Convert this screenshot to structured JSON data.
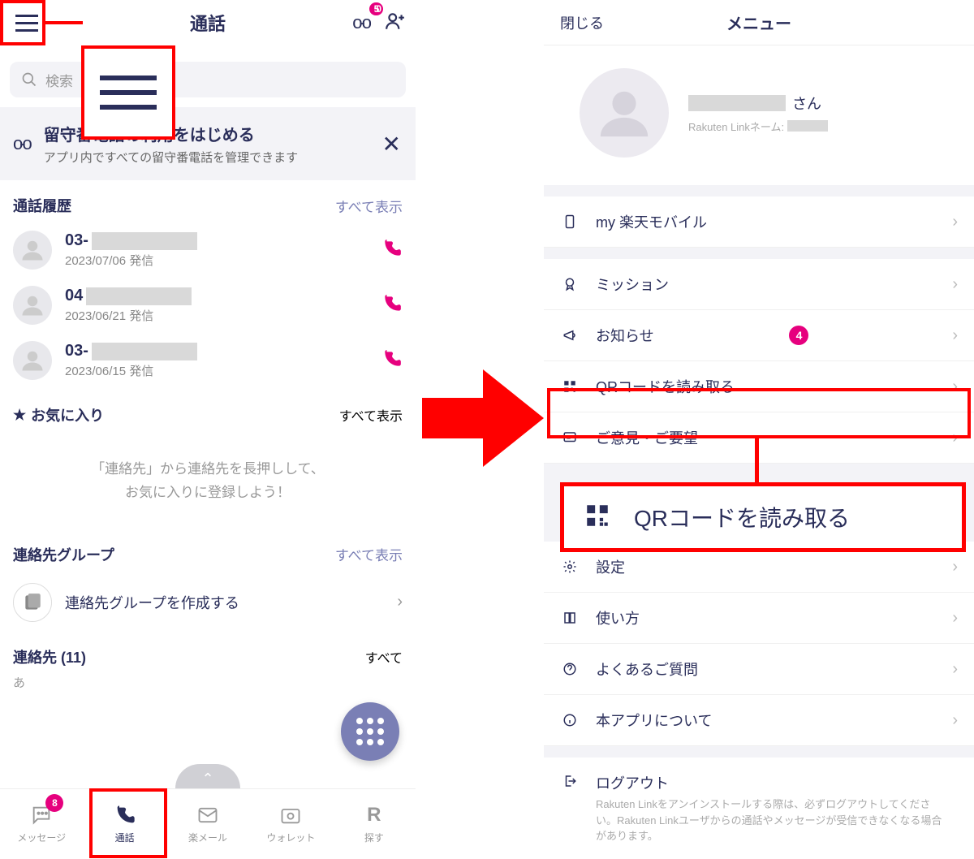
{
  "left": {
    "header_title": "通話",
    "voicemail_badge": "50",
    "search_placeholder": "検索",
    "banner": {
      "title": "留守番電話の利用をはじめる",
      "subtitle": "アプリ内ですべての留守番電話を管理できます"
    },
    "history": {
      "label": "通話履歴",
      "show_all": "すべて表示",
      "rows": [
        {
          "prefix": "03-",
          "date": "2023/07/06 発信"
        },
        {
          "prefix": "04",
          "date": "2023/06/21 発信"
        },
        {
          "prefix": "03-",
          "date": "2023/06/15 発信"
        }
      ]
    },
    "favorites": {
      "label": "お気に入り",
      "show_all": "すべて表示",
      "empty_line1": "「連絡先」から連絡先を長押しして、",
      "empty_line2": "お気に入りに登録しよう！"
    },
    "groups": {
      "label": "連絡先グループ",
      "show_all": "すべて表示",
      "create": "連絡先グループを作成する"
    },
    "contacts": {
      "label": "連絡先 (11)",
      "show_all": "すべて",
      "kana": "あ"
    },
    "tabs": {
      "message": "メッセージ",
      "message_badge": "8",
      "call": "通話",
      "mail": "楽メール",
      "wallet": "ウォレット",
      "search": "探す"
    }
  },
  "right": {
    "close": "閉じる",
    "title": "メニュー",
    "profile": {
      "san": "さん",
      "sub_prefix": "Rakuten Linkネーム:"
    },
    "items": {
      "my_rakuten": "my 楽天モバイル",
      "mission": "ミッション",
      "news": "お知らせ",
      "news_badge": "4",
      "qr": "QRコードを読み取る",
      "feedback": "ご意見・ご要望",
      "settings": "設定",
      "howto": "使い方",
      "faq": "よくあるご質問",
      "about": "本アプリについて",
      "logout": "ログアウト",
      "logout_desc": "Rakuten Linkをアンインストールする際は、必ずログアウトしてください。Rakuten Linkユーザからの通話やメッセージが受信できなくなる場合があります。"
    },
    "callout": "QRコードを読み取る"
  }
}
